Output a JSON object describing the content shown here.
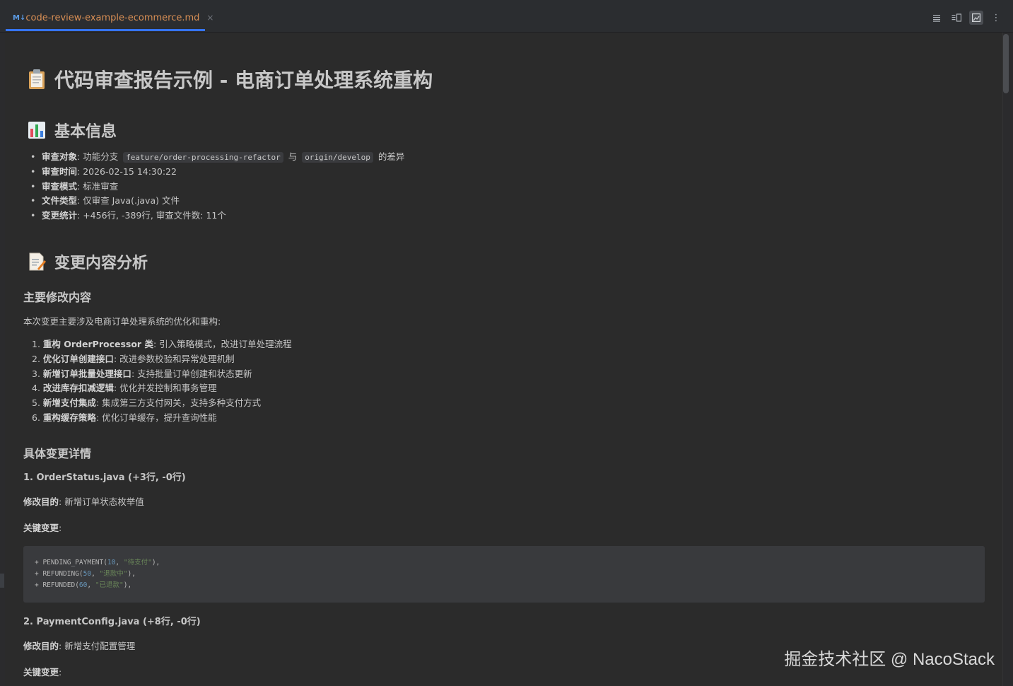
{
  "tab": {
    "icon_label": "M↓",
    "filename": "code-review-example-ecommerce.md",
    "close_glyph": "×"
  },
  "toolbar": {
    "more_glyph": "⋮"
  },
  "doc": {
    "title": "代码审查报告示例 - 电商订单处理系统重构",
    "basic_info": {
      "heading": "基本信息",
      "items": [
        {
          "label": "审查对象",
          "text_before": ": 功能分支 ",
          "code1": "feature/order-processing-refactor",
          "middle": " 与 ",
          "code2": "origin/develop",
          "text_after": " 的差异"
        },
        {
          "label": "审查时间",
          "text": ": 2026-02-15 14:30:22"
        },
        {
          "label": "审查模式",
          "text": ": 标准审查"
        },
        {
          "label": "文件类型",
          "text": ": 仅审查 Java(.java) 文件"
        },
        {
          "label": "变更统计",
          "text": ": +456行, -389行, 审查文件数: 11个"
        }
      ]
    },
    "change_analysis": {
      "heading": "变更内容分析",
      "main_changes_heading": "主要修改内容",
      "intro": "本次变更主要涉及电商订单处理系统的优化和重构:",
      "list": [
        {
          "n": "1.",
          "label": "重构 OrderProcessor 类",
          "text": ": 引入策略模式，改进订单处理流程"
        },
        {
          "n": "2.",
          "label": "优化订单创建接口",
          "text": ": 改进参数校验和异常处理机制"
        },
        {
          "n": "3.",
          "label": "新增订单批量处理接口",
          "text": ": 支持批量订单创建和状态更新"
        },
        {
          "n": "4.",
          "label": "改进库存扣减逻辑",
          "text": ": 优化并发控制和事务管理"
        },
        {
          "n": "5.",
          "label": "新增支付集成",
          "text": ": 集成第三方支付网关，支持多种支付方式"
        },
        {
          "n": "6.",
          "label": "重构缓存策略",
          "text": ": 优化订单缓存，提升查询性能"
        }
      ],
      "details_heading": "具体变更详情",
      "files": [
        {
          "title": "1. OrderStatus.java (+3行, -0行)",
          "purpose_label": "修改目的",
          "purpose": ": 新增订单状态枚举值",
          "key_label": "关键变更",
          "key_suffix": ":",
          "code": [
            {
              "prefix": "+ PENDING_PAYMENT(",
              "num": "10",
              "sep": ", ",
              "str": "\"待支付\"",
              "end": "),"
            },
            {
              "prefix": "+ REFUNDING(",
              "num": "50",
              "sep": ", ",
              "str": "\"退款中\"",
              "end": "),"
            },
            {
              "prefix": "+ REFUNDED(",
              "num": "60",
              "sep": ", ",
              "str": "\"已退款\"",
              "end": "),"
            }
          ]
        },
        {
          "title": "2. PaymentConfig.java (+8行, -0行)",
          "purpose_label": "修改目的",
          "purpose": ": 新增支付配置管理",
          "key_label": "关键变更",
          "key_suffix": ":"
        }
      ]
    }
  },
  "watermark": "掘金技术社区 @ NacoStack"
}
